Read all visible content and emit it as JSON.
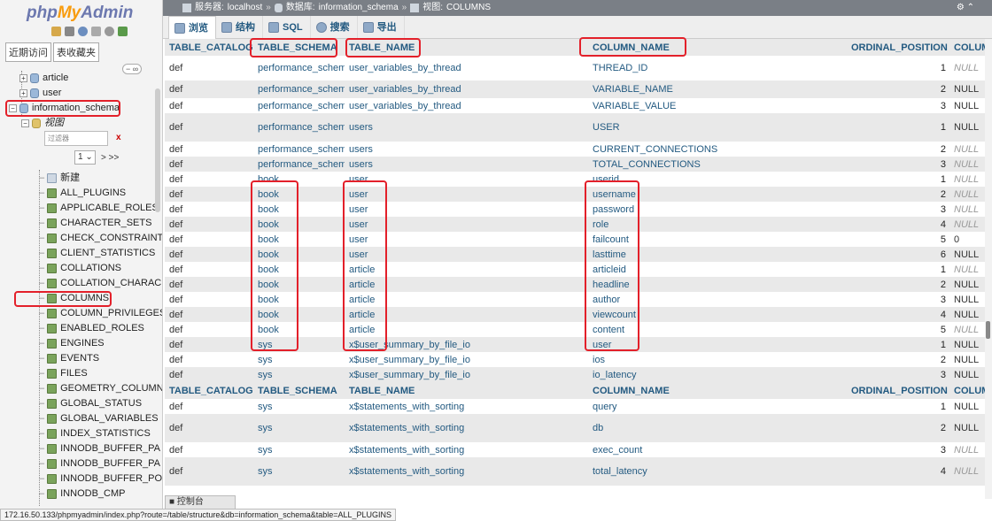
{
  "sidebar": {
    "logo_php": "php",
    "logo_my": "My",
    "logo_admin": "Admin",
    "tab_recent": "近期访问",
    "tab_favorites": "表收藏夹",
    "db_article": "article",
    "db_user": "user",
    "db_information_schema": "information_schema",
    "views_label": "视图",
    "filter_placeholder": "过滤器",
    "filter_clear": "x",
    "page_value": "1",
    "page_next": "> >>",
    "new_label": "新建",
    "views": [
      "ALL_PLUGINS",
      "APPLICABLE_ROLES",
      "CHARACTER_SETS",
      "CHECK_CONSTRAINT",
      "CLIENT_STATISTICS",
      "COLLATIONS",
      "COLLATION_CHARAC",
      "COLUMNS",
      "COLUMN_PRIVILEGES",
      "ENABLED_ROLES",
      "ENGINES",
      "EVENTS",
      "FILES",
      "GEOMETRY_COLUMN",
      "GLOBAL_STATUS",
      "GLOBAL_VARIABLES",
      "INDEX_STATISTICS",
      "INNODB_BUFFER_PA",
      "INNODB_BUFFER_PA",
      "INNODB_BUFFER_PO",
      "INNODB_CMP"
    ]
  },
  "breadcrumb": {
    "server_label": "服务器:",
    "server": "localhost",
    "db_label": "数据库:",
    "db": "information_schema",
    "view_label": "视图:",
    "view": "COLUMNS"
  },
  "tabs": [
    "浏览",
    "结构",
    "SQL",
    "搜索",
    "导出"
  ],
  "columns": [
    "TABLE_CATALOG",
    "TABLE_SCHEMA",
    "TABLE_NAME",
    "COLUMN_NAME",
    "ORDINAL_POSITION",
    "COLUM"
  ],
  "rows_a": [
    {
      "cat": "def",
      "schema": "performance_schema",
      "table": "user_variables_by_thread",
      "col": "THREAD_ID",
      "pos": "1",
      "nul": "NULL",
      "italic": true,
      "h": 28
    },
    {
      "cat": "def",
      "schema": "performance_schema",
      "table": "user_variables_by_thread",
      "col": "VARIABLE_NAME",
      "pos": "2",
      "nul": "NULL",
      "italic": false,
      "h": 20
    },
    {
      "cat": "def",
      "schema": "performance_schema",
      "table": "user_variables_by_thread",
      "col": "VARIABLE_VALUE",
      "pos": "3",
      "nul": "NULL",
      "italic": false,
      "h": 17
    },
    {
      "cat": "def",
      "schema": "performance_schema",
      "table": "users",
      "col": "USER",
      "pos": "1",
      "nul": "NULL",
      "italic": false,
      "h": 32
    },
    {
      "cat": "def",
      "schema": "performance_schema",
      "table": "users",
      "col": "CURRENT_CONNECTIONS",
      "pos": "2",
      "nul": "NULL",
      "italic": true,
      "h": 17
    },
    {
      "cat": "def",
      "schema": "performance_schema",
      "table": "users",
      "col": "TOTAL_CONNECTIONS",
      "pos": "3",
      "nul": "NULL",
      "italic": true,
      "h": 17
    },
    {
      "cat": "def",
      "schema": "book",
      "table": "user",
      "col": "userid",
      "pos": "1",
      "nul": "NULL",
      "italic": true,
      "h": 17
    },
    {
      "cat": "def",
      "schema": "book",
      "table": "user",
      "col": "username",
      "pos": "2",
      "nul": "NULL",
      "italic": true,
      "h": 17
    },
    {
      "cat": "def",
      "schema": "book",
      "table": "user",
      "col": "password",
      "pos": "3",
      "nul": "NULL",
      "italic": true,
      "h": 17
    },
    {
      "cat": "def",
      "schema": "book",
      "table": "user",
      "col": "role",
      "pos": "4",
      "nul": "NULL",
      "italic": true,
      "h": 17
    },
    {
      "cat": "def",
      "schema": "book",
      "table": "user",
      "col": "failcount",
      "pos": "5",
      "nul": "0",
      "italic": false,
      "h": 17
    },
    {
      "cat": "def",
      "schema": "book",
      "table": "user",
      "col": "lasttime",
      "pos": "6",
      "nul": "NULL",
      "italic": false,
      "h": 17
    },
    {
      "cat": "def",
      "schema": "book",
      "table": "article",
      "col": "articleid",
      "pos": "1",
      "nul": "NULL",
      "italic": true,
      "h": 17
    },
    {
      "cat": "def",
      "schema": "book",
      "table": "article",
      "col": "headline",
      "pos": "2",
      "nul": "NULL",
      "italic": false,
      "h": 17
    },
    {
      "cat": "def",
      "schema": "book",
      "table": "article",
      "col": "author",
      "pos": "3",
      "nul": "NULL",
      "italic": false,
      "h": 17
    },
    {
      "cat": "def",
      "schema": "book",
      "table": "article",
      "col": "viewcount",
      "pos": "4",
      "nul": "NULL",
      "italic": false,
      "h": 17
    },
    {
      "cat": "def",
      "schema": "book",
      "table": "article",
      "col": "content",
      "pos": "5",
      "nul": "NULL",
      "italic": true,
      "h": 17
    },
    {
      "cat": "def",
      "schema": "sys",
      "table": "x$user_summary_by_file_io",
      "col": "user",
      "pos": "1",
      "nul": "NULL",
      "italic": false,
      "h": 17
    },
    {
      "cat": "def",
      "schema": "sys",
      "table": "x$user_summary_by_file_io",
      "col": "ios",
      "pos": "2",
      "nul": "NULL",
      "italic": false,
      "h": 17
    },
    {
      "cat": "def",
      "schema": "sys",
      "table": "x$user_summary_by_file_io",
      "col": "io_latency",
      "pos": "3",
      "nul": "NULL",
      "italic": false,
      "h": 17
    }
  ],
  "rows_b": [
    {
      "cat": "def",
      "schema": "sys",
      "table": "x$statements_with_sorting",
      "col": "query",
      "pos": "1",
      "nul": "NULL",
      "italic": false,
      "h": 17
    },
    {
      "cat": "def",
      "schema": "sys",
      "table": "x$statements_with_sorting",
      "col": "db",
      "pos": "2",
      "nul": "NULL",
      "italic": false,
      "h": 32
    },
    {
      "cat": "def",
      "schema": "sys",
      "table": "x$statements_with_sorting",
      "col": "exec_count",
      "pos": "3",
      "nul": "NULL",
      "italic": true,
      "h": 17
    },
    {
      "cat": "def",
      "schema": "sys",
      "table": "x$statements_with_sorting",
      "col": "total_latency",
      "pos": "4",
      "nul": "NULL",
      "italic": true,
      "h": 32
    }
  ],
  "console_label": "控制台",
  "status_url": "172.16.50.133/phpmyadmin/index.php?route=/table/structure&db=information_schema&table=ALL_PLUGINS"
}
